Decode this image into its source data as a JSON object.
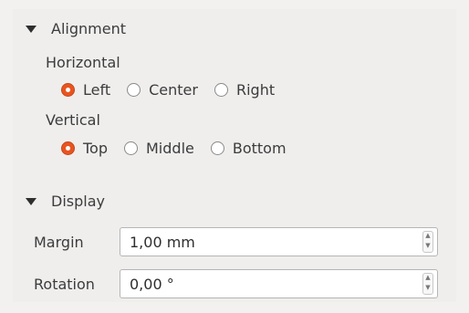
{
  "alignment": {
    "header": "Alignment",
    "horizontal": {
      "label": "Horizontal",
      "options": [
        "Left",
        "Center",
        "Right"
      ],
      "selected": "Left"
    },
    "vertical": {
      "label": "Vertical",
      "options": [
        "Top",
        "Middle",
        "Bottom"
      ],
      "selected": "Top"
    }
  },
  "display": {
    "header": "Display",
    "margin": {
      "label": "Margin",
      "value": "1,00 mm"
    },
    "rotation": {
      "label": "Rotation",
      "value": "0,00 °"
    }
  },
  "colors": {
    "accent": "#e95420"
  },
  "icons": {
    "collapse": "triangle-down-icon",
    "spin_up": "chevron-up-icon",
    "spin_down": "chevron-down-icon"
  }
}
